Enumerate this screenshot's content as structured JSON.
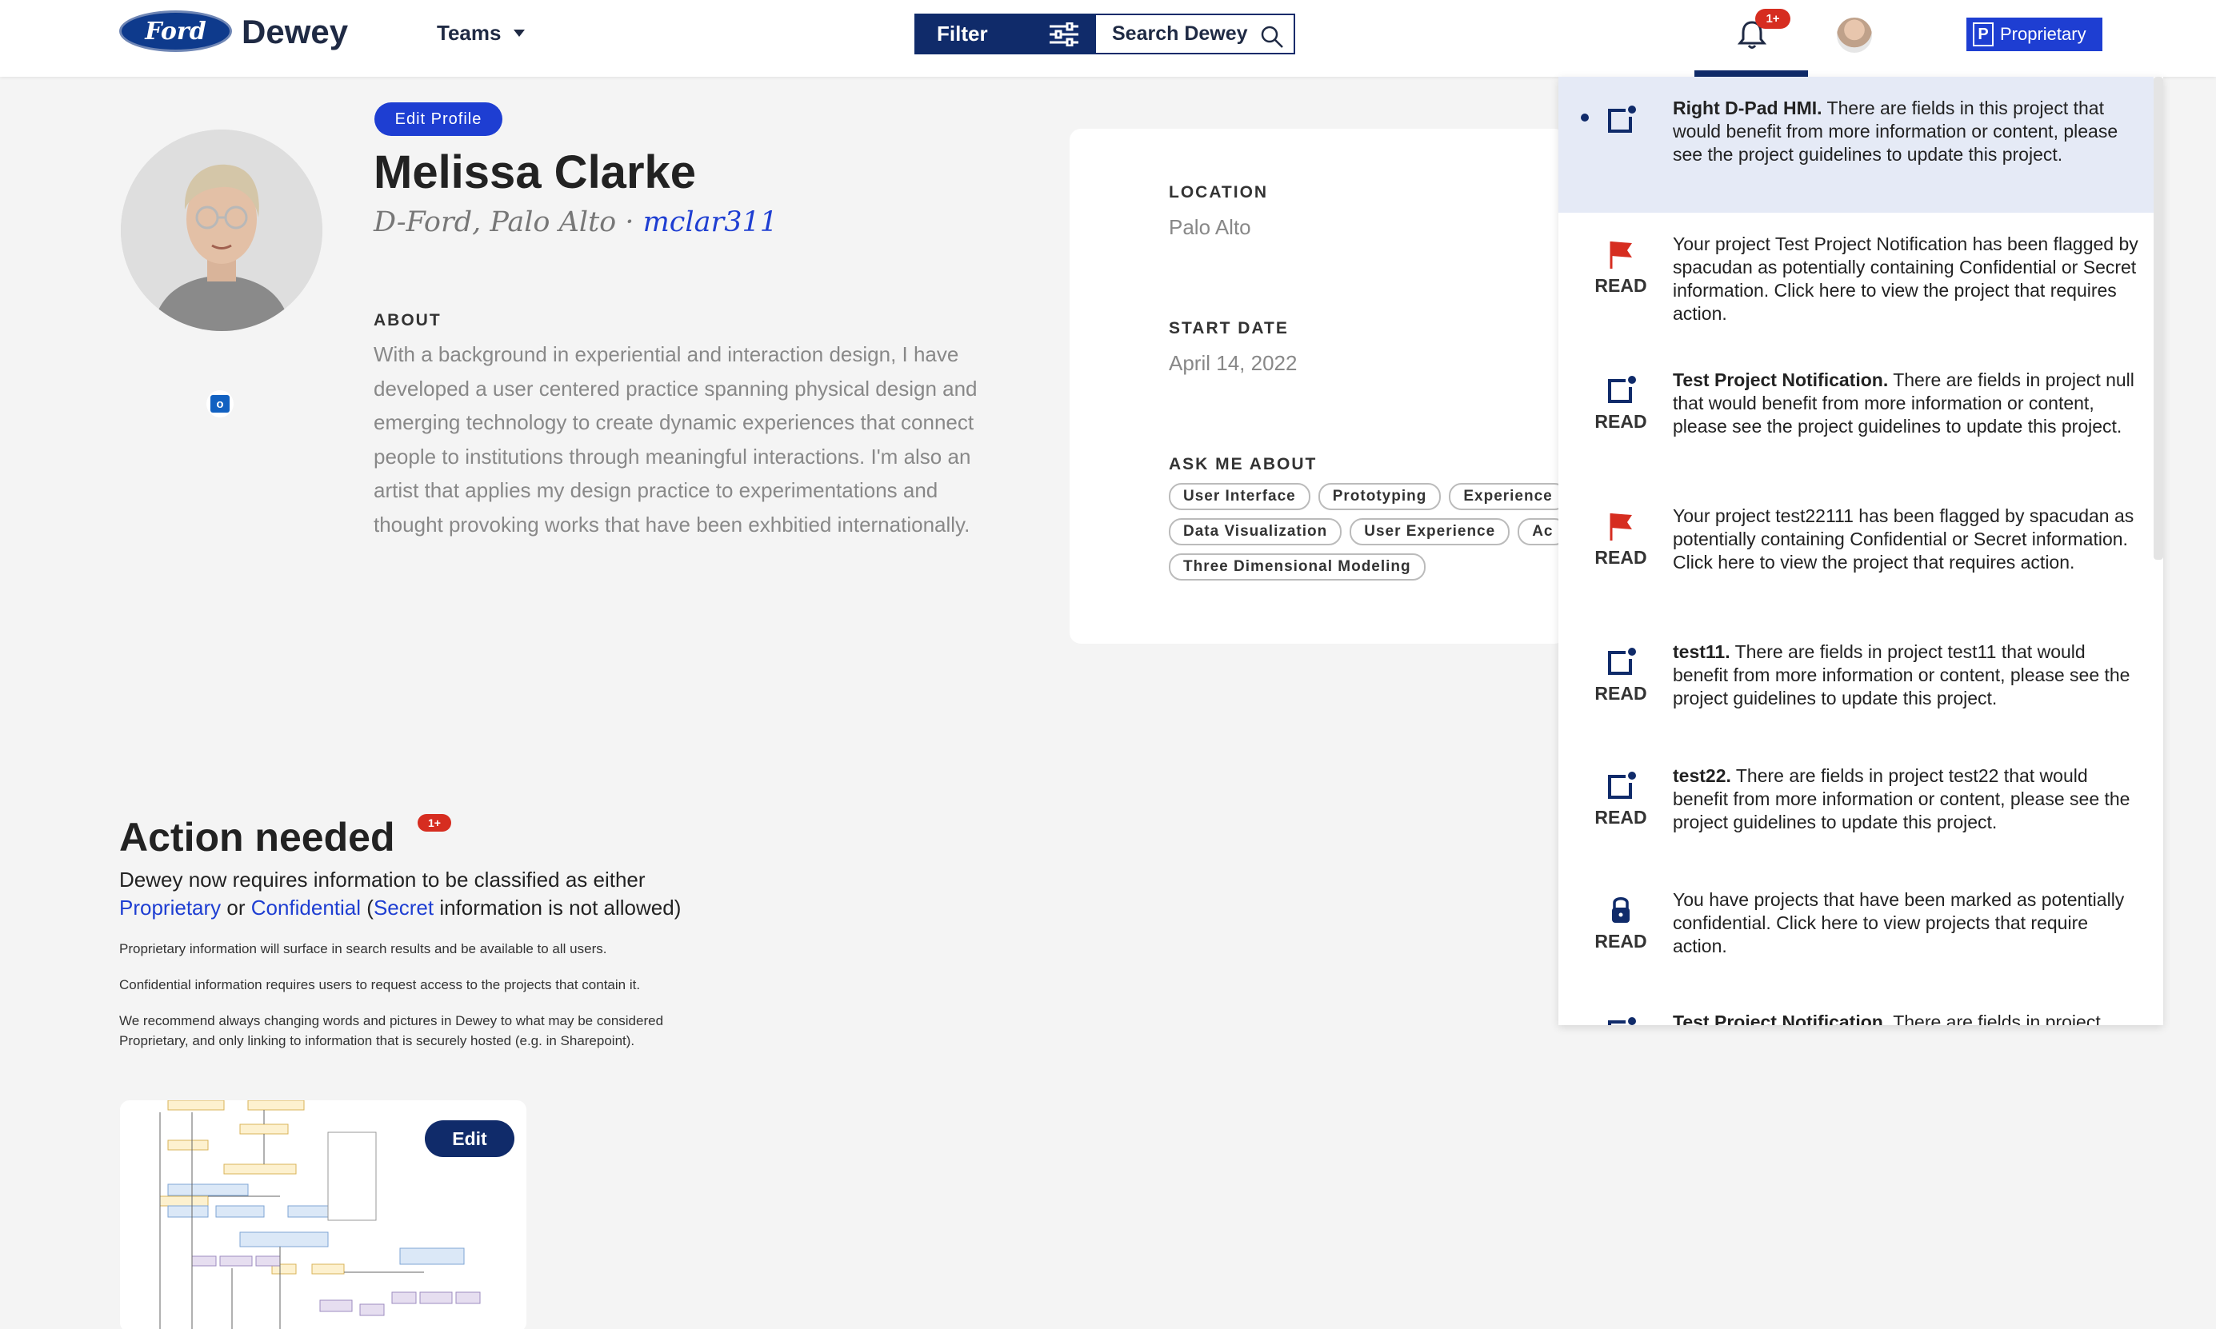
{
  "header": {
    "logo_text": "Ford",
    "brand": "Dewey",
    "teams_label": "Teams",
    "filter_label": "Filter",
    "search_label": "Search Dewey",
    "notification_badge": "1+",
    "classification_letter": "P",
    "classification_label": "Proprietary"
  },
  "profile": {
    "edit_label": "Edit Profile",
    "name": "Melissa Clarke",
    "org_location": "D-Ford, Palo Alto ·",
    "username": "mclar311",
    "about_heading": "ABOUT",
    "about_text": "With a background in experiential and interaction design, I have developed a user centered practice spanning physical design and emerging technology to create dynamic experiences that connect people to institutions through meaningful interactions. I'm also an artist that applies my design practice to experimentations and thought provoking works that have been exhbitied internationally."
  },
  "info": {
    "location_label": "LOCATION",
    "location_value": "Palo Alto",
    "start_label": "START DATE",
    "start_value": "April 14, 2022",
    "ask_label": "ASK ME ABOUT",
    "chips_row1": [
      "User Interface",
      "Prototyping",
      "Experience"
    ],
    "chips_row2": [
      "Data Visualization",
      "User Experience",
      "Ac"
    ],
    "chips_row3": [
      "Three Dimensional Modeling"
    ]
  },
  "action": {
    "heading": "Action needed",
    "badge": "1+",
    "line1": "Dewey now requires information to be classified as either",
    "proprietary": "Proprietary",
    "or": " or ",
    "confidential": "Confidential",
    "paren_open": " (",
    "secret": "Secret",
    "not_allowed": " information is not allowed)",
    "note1": "Proprietary information will surface in search results and be available to all users.",
    "note2": "Confidential information requires users to request access to the projects that contain it.",
    "note3": "We recommend always changing words and pictures in Dewey to what may be considered Proprietary, and only linking to information that is securely hosted (e.g. in Sharepoint).",
    "edit_label": "Edit"
  },
  "notifications": [
    {
      "icon": "project-icon",
      "read": "",
      "title": "Right D-Pad HMI.",
      "text": " There are fields in this project that would benefit from more information or content, please see the project guidelines to update this project."
    },
    {
      "icon": "flag-icon",
      "read": "READ",
      "title": "",
      "text": "Your project Test Project Notification has been flagged by spacudan as potentially containing Confidential or Secret information. Click here to view the project that requires action."
    },
    {
      "icon": "project-icon",
      "read": "READ",
      "title": "Test Project Notification.",
      "text": " There are fields in project null that would benefit from more information or content, please see the project guidelines to update this project."
    },
    {
      "icon": "flag-icon",
      "read": "READ",
      "title": "",
      "text": "Your project test22111 has been flagged by spacudan as potentially containing Confidential or Secret information. Click here to view the project that requires action."
    },
    {
      "icon": "project-icon",
      "read": "READ",
      "title": "test11.",
      "text": " There are fields in project test11 that would benefit from more information or content, please see the project guidelines to update this project."
    },
    {
      "icon": "project-icon",
      "read": "READ",
      "title": "test22.",
      "text": " There are fields in project test22 that would benefit from more information or content, please see the project guidelines to update this project."
    },
    {
      "icon": "lock-icon",
      "read": "READ",
      "title": "",
      "text": "You have projects that have been marked as potentially confidential. Click here to view projects that require action."
    },
    {
      "icon": "project-icon",
      "read": "",
      "title": "Test Project Notification.",
      "text": " There are fields in project"
    }
  ],
  "colors": {
    "navy": "#102b6a",
    "accent_blue": "#1e3ed2",
    "badge_red": "#d62d20",
    "unread_bg": "#e5eaf6"
  }
}
